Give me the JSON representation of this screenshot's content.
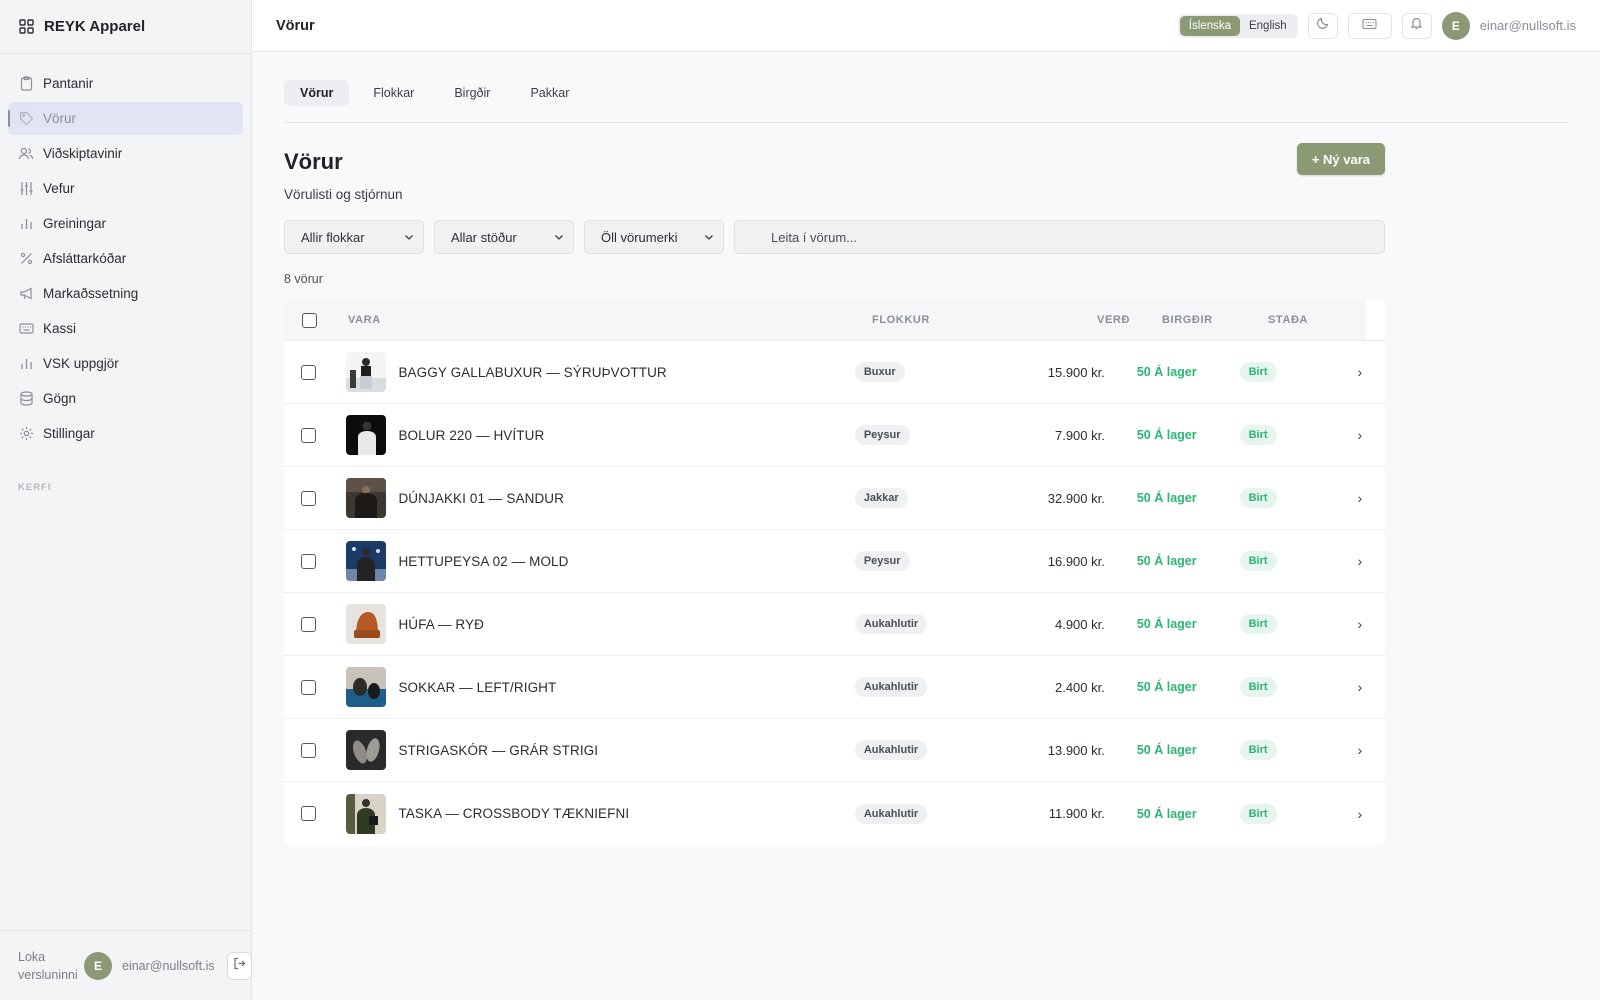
{
  "sidebar": {
    "brand": "REYK Apparel",
    "items": [
      {
        "label": "Pantanir",
        "icon": "clipboard-icon"
      },
      {
        "label": "Vörur",
        "icon": "tag-icon",
        "active": true
      },
      {
        "label": "Viðskiptavinir",
        "icon": "users-icon"
      },
      {
        "label": "Vefur",
        "icon": "sliders-icon"
      },
      {
        "label": "Greiningar",
        "icon": "bar-chart-icon"
      },
      {
        "label": "Afsláttarkóðar",
        "icon": "percent-icon"
      },
      {
        "label": "Markaðssetning",
        "icon": "megaphone-icon"
      },
      {
        "label": "Kassi",
        "icon": "keyboard-icon"
      },
      {
        "label": "VSK uppgjör",
        "icon": "bar-chart-icon"
      },
      {
        "label": "Gögn",
        "icon": "database-icon"
      },
      {
        "label": "Stillingar",
        "icon": "gear-icon"
      }
    ],
    "section_label": "KERFI",
    "footer": {
      "close_store": "Loka versluninni",
      "avatar_initial": "E",
      "email": "einar@nullsoft.is"
    }
  },
  "topbar": {
    "title": "Vörur",
    "languages": [
      "Íslenska",
      "English"
    ],
    "active_language": "Íslenska",
    "avatar_initial": "E",
    "email": "einar@nullsoft.is"
  },
  "tabs": [
    "Vörur",
    "Flokkar",
    "Birgðir",
    "Pakkar"
  ],
  "page": {
    "title": "Vörur",
    "subtitle": "Vörulisti og stjórnun",
    "new_button": "+ Ný vara",
    "filters": [
      "Allir flokkar",
      "Allar stöður",
      "Öll vörumerki"
    ],
    "search_placeholder": "Leita í vörum...",
    "count": "8 vörur"
  },
  "table": {
    "columns": [
      "VARA",
      "FLOKKUR",
      "VERÐ",
      "BIRGÐIR",
      "STAÐA"
    ],
    "rows": [
      {
        "name": "BAGGY GALLABUXUR — SÝRUÞVOTTUR",
        "category": "Buxur",
        "price": "15.900 kr.",
        "stock": "50 Á lager",
        "status": "Birt"
      },
      {
        "name": "BOLUR 220 — HVÍTUR",
        "category": "Peysur",
        "price": "7.900 kr.",
        "stock": "50 Á lager",
        "status": "Birt"
      },
      {
        "name": "DÚNJAKKI 01 — SANDUR",
        "category": "Jakkar",
        "price": "32.900 kr.",
        "stock": "50 Á lager",
        "status": "Birt"
      },
      {
        "name": "HETTUPEYSA 02 — MOLD",
        "category": "Peysur",
        "price": "16.900 kr.",
        "stock": "50 Á lager",
        "status": "Birt"
      },
      {
        "name": "HÚFA — RYÐ",
        "category": "Aukahlutir",
        "price": "4.900 kr.",
        "stock": "50 Á lager",
        "status": "Birt"
      },
      {
        "name": "SOKKAR — LEFT/RIGHT",
        "category": "Aukahlutir",
        "price": "2.400 kr.",
        "stock": "50 Á lager",
        "status": "Birt"
      },
      {
        "name": "STRIGASKÓR — GRÁR STRIGI",
        "category": "Aukahlutir",
        "price": "13.900 kr.",
        "stock": "50 Á lager",
        "status": "Birt"
      },
      {
        "name": "TASKA — CROSSBODY TÆKNIEFNI",
        "category": "Aukahlutir",
        "price": "11.900 kr.",
        "stock": "50 Á lager",
        "status": "Birt"
      }
    ]
  },
  "colors": {
    "accent": "#8b9a74",
    "stock_green": "#2bb673",
    "active_nav_bg": "#e1e4f2"
  }
}
